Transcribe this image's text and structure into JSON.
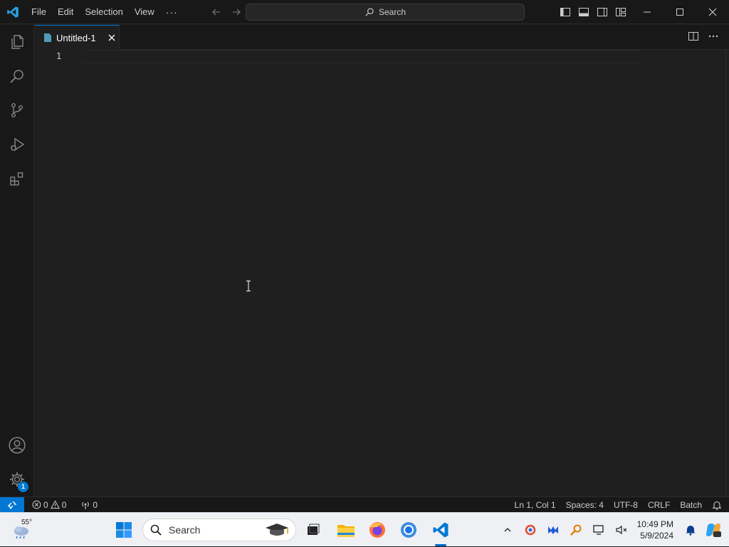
{
  "titlebar": {
    "menu": [
      "File",
      "Edit",
      "Selection",
      "View"
    ],
    "more": "···",
    "search_label": "Search"
  },
  "tab": {
    "label": "Untitled-1"
  },
  "editor": {
    "line_numbers": [
      "1"
    ]
  },
  "activity_bar": {
    "items": [
      "explorer",
      "search",
      "source-control",
      "run-and-debug",
      "extensions"
    ],
    "bottom": [
      "accounts",
      "manage"
    ],
    "manage_badge": "1"
  },
  "statusbar": {
    "errors": "0",
    "warnings": "0",
    "ports": "0",
    "position": "Ln 1, Col 1",
    "spaces": "Spaces: 4",
    "encoding": "UTF-8",
    "eol": "CRLF",
    "language": "Batch"
  },
  "taskbar": {
    "weather_temp": "55°",
    "search_placeholder": "Search",
    "time": "10:49 PM",
    "date": "5/9/2024"
  },
  "colors": {
    "accent": "#0078d4",
    "editor_bg": "#1f1f1f",
    "chrome_bg": "#181818",
    "taskbar_bg": "#eef0f4"
  }
}
